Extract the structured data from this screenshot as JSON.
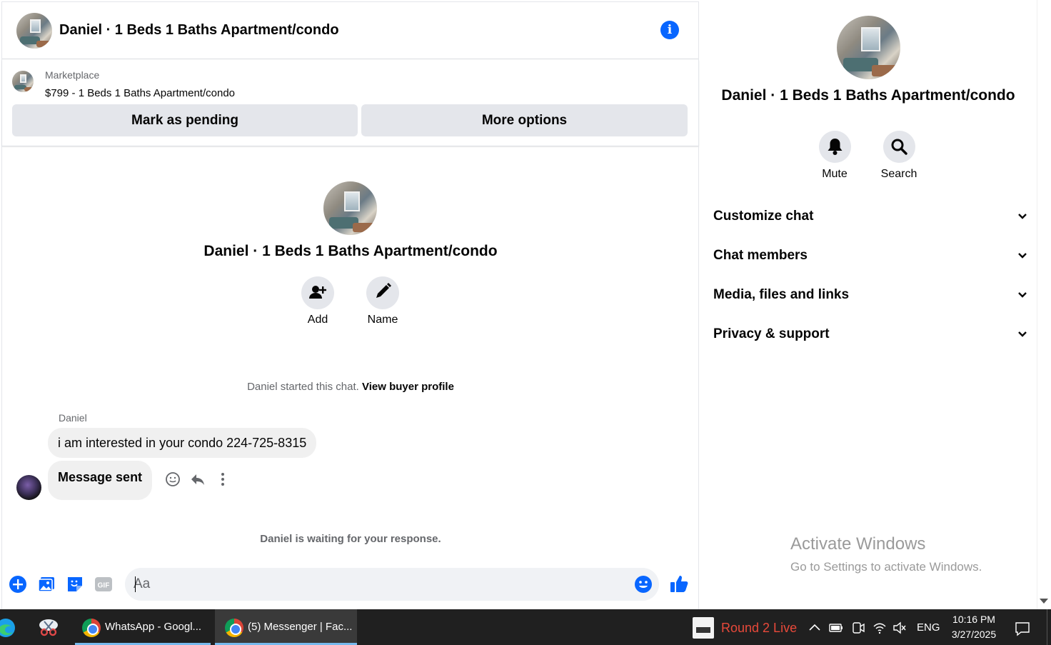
{
  "header": {
    "title": "Daniel · 1 Beds 1 Baths Apartment/condo"
  },
  "marketplace": {
    "label": "Marketplace",
    "item": "$799 - 1 Beds 1 Baths Apartment/condo",
    "mark_pending_label": "Mark as pending",
    "more_options_label": "More options"
  },
  "profile": {
    "name": "Daniel · 1 Beds 1 Baths Apartment/condo",
    "add_label": "Add",
    "name_label": "Name"
  },
  "conversation": {
    "started_text": "Daniel started this chat.",
    "view_profile_link": "View buyer profile",
    "sender_name": "Daniel",
    "messages": [
      {
        "text": "i am interested in your condo 224-725-8315"
      },
      {
        "text": "Message sent"
      }
    ],
    "waiting_text": "Daniel is waiting for your response."
  },
  "composer": {
    "placeholder": "Aa",
    "value": ""
  },
  "side_panel": {
    "name": "Daniel · 1 Beds 1 Baths Apartment/condo",
    "actions": [
      {
        "label": "Mute",
        "icon": "bell-icon"
      },
      {
        "label": "Search",
        "icon": "search-icon"
      }
    ],
    "sections": [
      {
        "label": "Customize chat"
      },
      {
        "label": "Chat members"
      },
      {
        "label": "Media, files and links"
      },
      {
        "label": "Privacy & support"
      }
    ]
  },
  "watermark": {
    "title": "Activate Windows",
    "subtitle": "Go to Settings to activate Windows."
  },
  "taskbar": {
    "apps": [
      {
        "label": "WhatsApp - Googl..."
      },
      {
        "label": "(5) Messenger | Fac..."
      }
    ],
    "live_label": "Round 2 Live",
    "language": "ENG",
    "time": "10:16 PM",
    "date": "3/27/2025"
  },
  "colors": {
    "accent": "#0866ff",
    "bubble": "#f0f0f0",
    "button_gray": "#e4e6eb",
    "taskbar": "#202020",
    "live_red": "#e8493a"
  }
}
